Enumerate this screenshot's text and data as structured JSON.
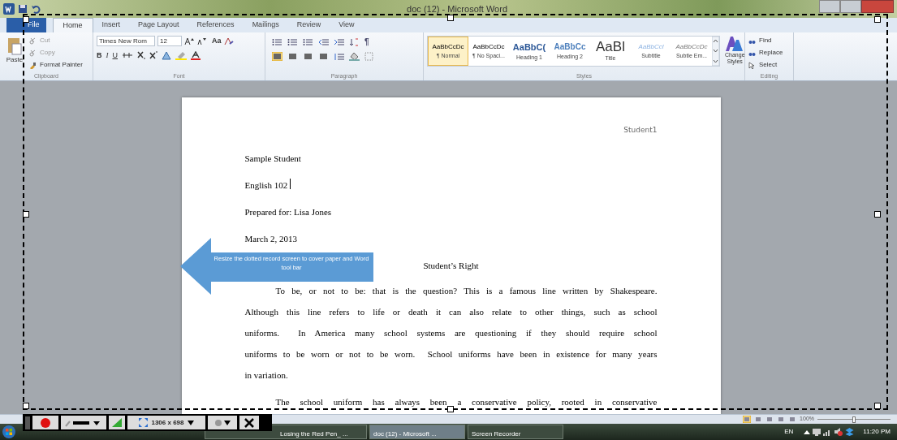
{
  "window": {
    "title": "doc (12) - Microsoft Word"
  },
  "tabs": [
    {
      "label": "File",
      "selected": false,
      "kind": "file"
    },
    {
      "label": "Home",
      "selected": true,
      "kind": "tab"
    },
    {
      "label": "Insert",
      "selected": false,
      "kind": "tab"
    },
    {
      "label": "Page Layout",
      "selected": false,
      "kind": "tab"
    },
    {
      "label": "References",
      "selected": false,
      "kind": "tab"
    },
    {
      "label": "Mailings",
      "selected": false,
      "kind": "tab"
    },
    {
      "label": "Review",
      "selected": false,
      "kind": "tab"
    },
    {
      "label": "View",
      "selected": false,
      "kind": "tab"
    }
  ],
  "clipboard": {
    "paste": "Paste",
    "cut": "Cut",
    "copy": "Copy",
    "format_painter": "Format Painter",
    "label": "Clipboard"
  },
  "font": {
    "name": "Times New Rom",
    "size": "12",
    "bold": "B",
    "italic": "I",
    "underline": "U",
    "change_case": "Aa",
    "label": "Font"
  },
  "paragraph": {
    "label": "Paragraph",
    "pilcrow": "¶"
  },
  "styles": {
    "label": "Styles",
    "items": [
      {
        "preview": "AaBbCcDc",
        "name": "¶ Normal",
        "selected": true
      },
      {
        "preview": "AaBbCcDc",
        "name": "¶ No Spaci...",
        "selected": false
      },
      {
        "preview": "AaBbC(",
        "name": "Heading 1",
        "selected": false
      },
      {
        "preview": "AaBbCc",
        "name": "Heading 2",
        "selected": false
      },
      {
        "preview": "AaBl",
        "name": "Title",
        "selected": false
      },
      {
        "preview": "AaBbCcl",
        "name": "Subtitle",
        "selected": false
      },
      {
        "preview": "AaBbCcDc",
        "name": "Subtle Em...",
        "selected": false
      }
    ],
    "change_styles": "Change Styles"
  },
  "editing": {
    "find": "Find",
    "replace": "Replace",
    "select": "Select",
    "label": "Editing"
  },
  "document": {
    "header": "Student1",
    "heading_lines": [
      "Sample Student",
      "English 102",
      "Prepared for: Lisa Jones",
      "March 2, 2013"
    ],
    "title": "Student’s Right",
    "paragraph_1": [
      "To be, or not to be: that is the question? This is a famous line written by Shakespeare.",
      "Although this line refers to life or death it can also relate to other things, such as school",
      "uniforms.  In America many school systems are questioning if they should require school",
      "uniforms to be worn or not to be worn.  School uniforms have been in existence for many years",
      "in variation."
    ],
    "paragraph_2": [
      "The school uniform has always been a conservative policy, rooted in conservative"
    ]
  },
  "callout": {
    "text": "Resize the dotted record screen to cover paper and Word tool bar"
  },
  "recorder": {
    "size": "1306 x 698"
  },
  "status_bar": {
    "zoom": "100%",
    "zoom_slider": {
      "level": 0.5
    }
  },
  "taskbar": {
    "windows": [
      {
        "label": "Losing the Red Pen_ ...",
        "selected": false
      },
      {
        "label": "doc (12) - Microsoft ...",
        "selected": true
      },
      {
        "label": "Screen Recorder",
        "selected": false
      }
    ],
    "language": "EN",
    "time": "11:20 PM"
  }
}
